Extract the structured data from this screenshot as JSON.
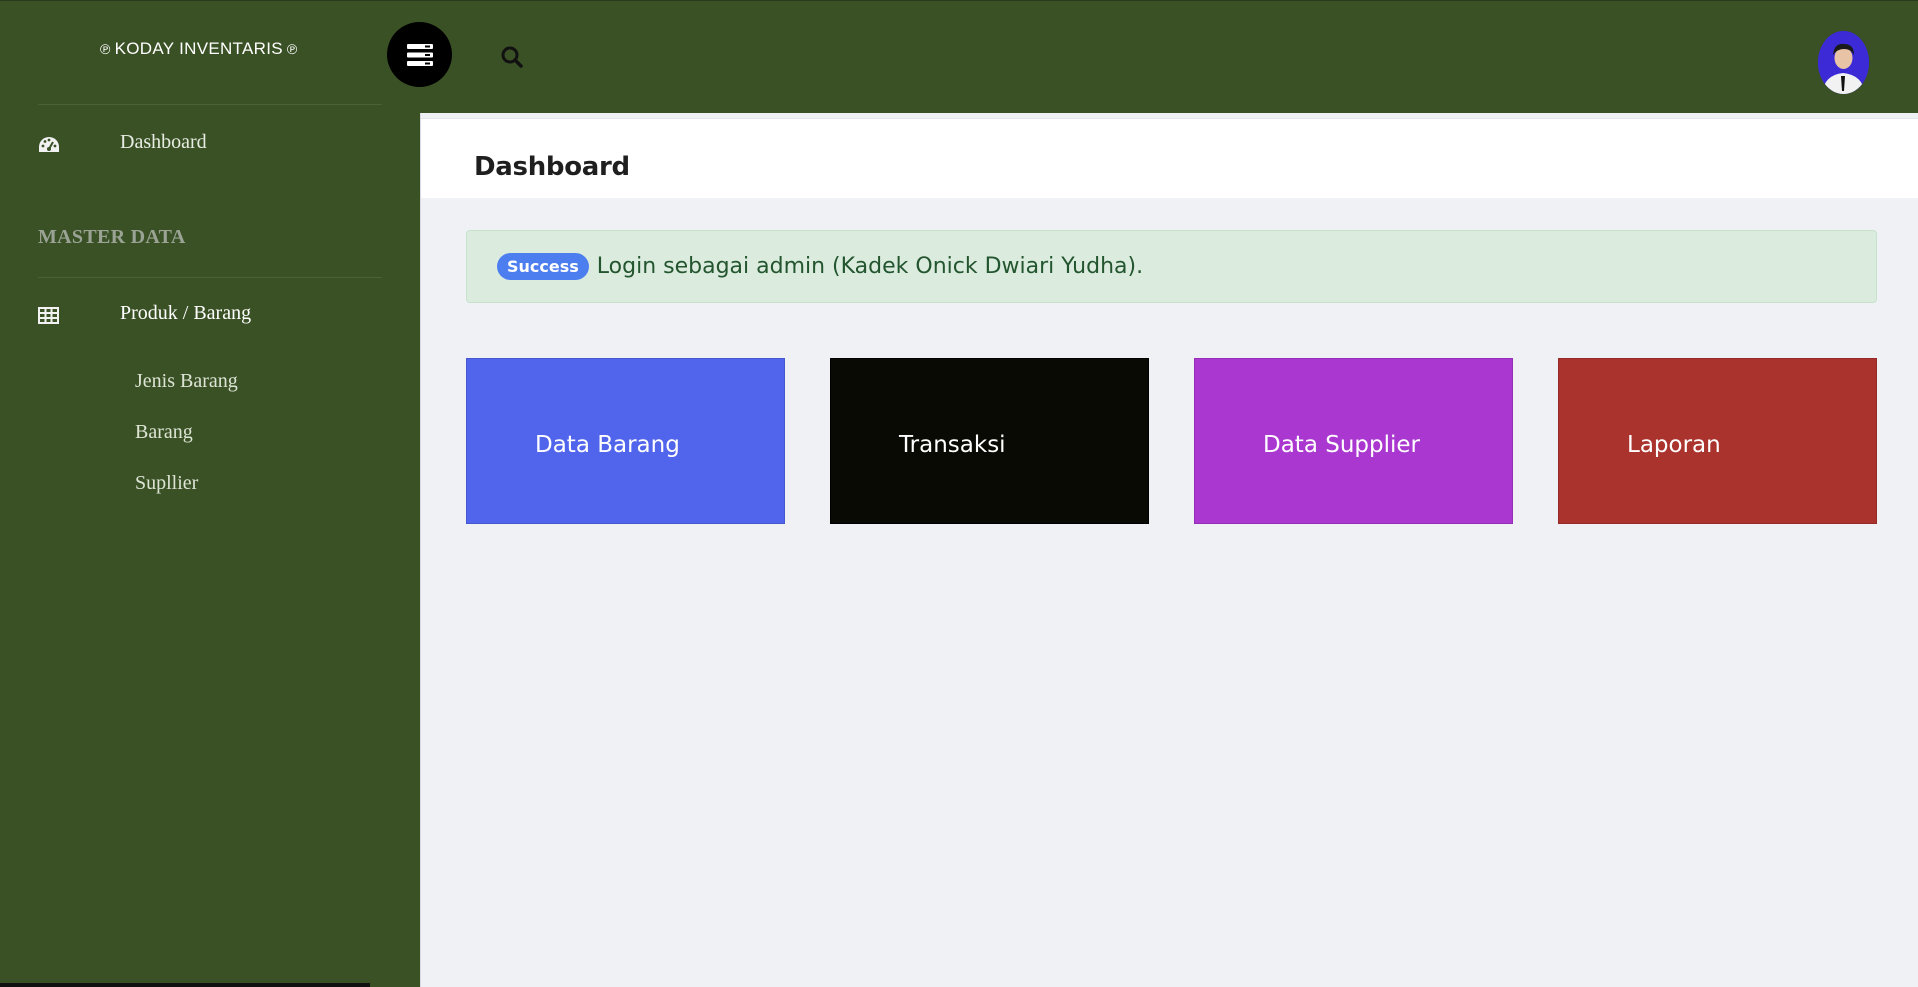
{
  "header": {
    "brand": "KODAY INVENTARIS",
    "brand_ornament": "℗",
    "toggle_icon": "menu-icon",
    "search_icon": "search-icon",
    "avatar_icon": "user-avatar"
  },
  "sidebar": {
    "dashboard_label": "Dashboard",
    "section_title": "MASTER DATA",
    "produk_label": "Produk / Barang",
    "sub_items": [
      "Jenis Barang",
      "Barang",
      "Supllier"
    ]
  },
  "main": {
    "page_title": "Dashboard",
    "alert": {
      "badge": "Success",
      "text": "Login sebagai admin (Kadek Onick Dwiari Yudha)."
    },
    "cards": [
      {
        "label": "Data Barang",
        "color": "#5065eb"
      },
      {
        "label": "Transaksi",
        "color": "#0a0a05"
      },
      {
        "label": "Data Supplier",
        "color": "#aa38d0"
      },
      {
        "label": "Laporan",
        "color": "#aa332e"
      }
    ]
  },
  "colors": {
    "sidebar_bg": "#3a5126",
    "content_bg": "#eff1f5",
    "alert_bg": "#dbecdf",
    "badge_bg": "#4d7ef0"
  }
}
